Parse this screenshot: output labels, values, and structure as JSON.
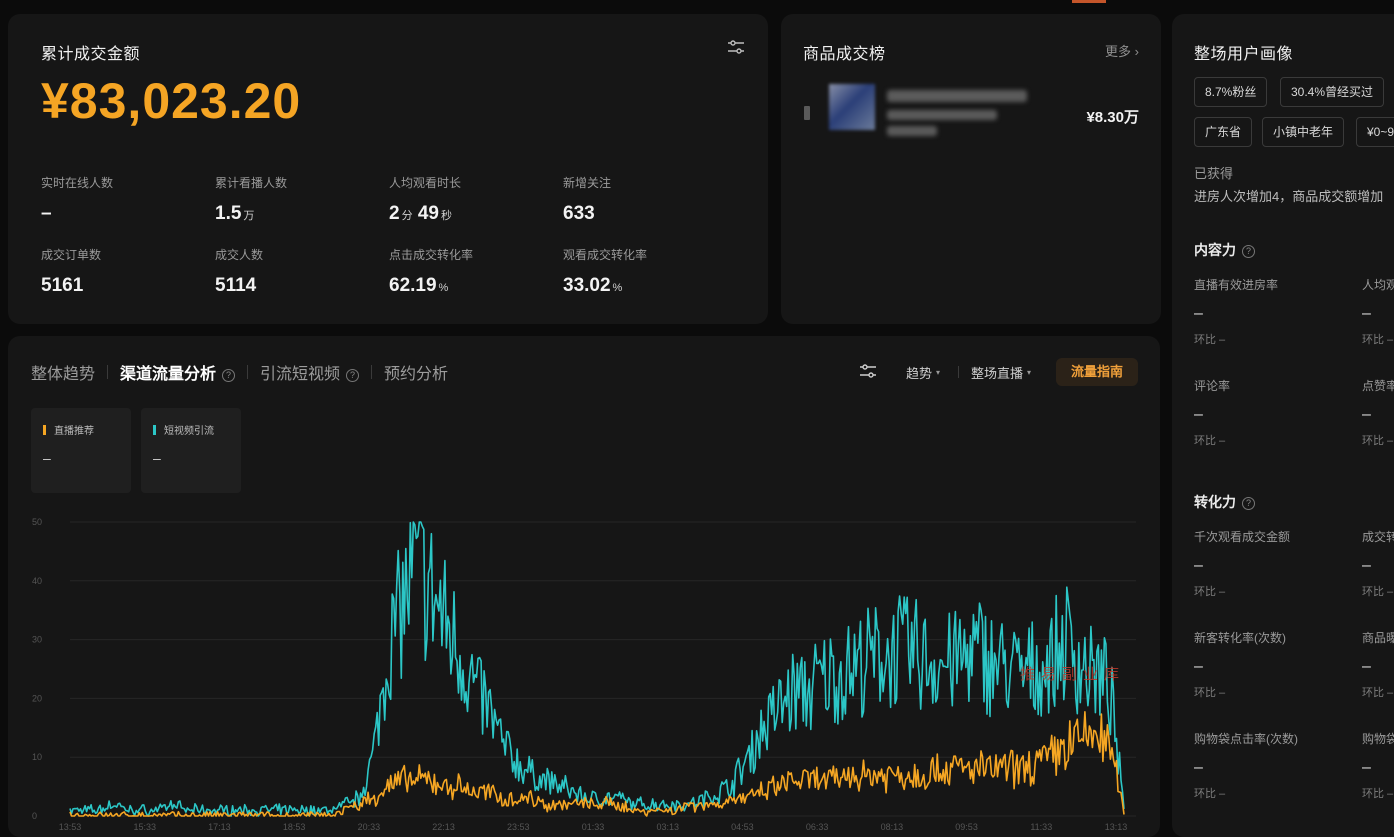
{
  "summary": {
    "title": "累计成交金额",
    "amount": "¥83,023.20",
    "metrics": [
      {
        "label": "实时在线人数",
        "value": "–",
        "unit": ""
      },
      {
        "label": "累计看播人数",
        "value": "1.5",
        "unit": "万"
      },
      {
        "label": "人均观看时长",
        "value": "2",
        "unit": "分",
        "value2": "49",
        "unit2": "秒"
      },
      {
        "label": "新增关注",
        "value": "633",
        "unit": ""
      },
      {
        "label": "成交订单数",
        "value": "5161",
        "unit": ""
      },
      {
        "label": "成交人数",
        "value": "5114",
        "unit": ""
      },
      {
        "label": "点击成交转化率",
        "value": "62.19",
        "unit": "%"
      },
      {
        "label": "观看成交转化率",
        "value": "33.02",
        "unit": "%"
      }
    ]
  },
  "products": {
    "title": "商品成交榜",
    "more": "更多",
    "items": [
      {
        "price": "¥8.30万"
      }
    ]
  },
  "profile": {
    "title": "整场用户画像",
    "tags_row1": [
      "8.7%粉丝",
      "30.4%曾经买过"
    ],
    "tags_row2": [
      "广东省",
      "小镇中老年",
      "¥0~9"
    ],
    "obtained_label": "已获得",
    "obtained_text": "进房人次增加4，商品成交额增加",
    "sections": [
      {
        "title": "内容力",
        "help": "?",
        "items": [
          {
            "label": "直播有效进房率",
            "value": "–",
            "hb": "环比 –"
          },
          {
            "label": "人均观",
            "value": "–",
            "hb": "环比 –"
          },
          {
            "label": "评论率",
            "value": "–",
            "hb": "环比 –"
          },
          {
            "label": "点赞率",
            "value": "–",
            "hb": "环比 –"
          }
        ]
      },
      {
        "title": "转化力",
        "help": "?",
        "items": [
          {
            "label": "千次观看成交金额",
            "value": "–",
            "hb": "环比 –"
          },
          {
            "label": "成交转",
            "value": "–",
            "hb": "环比 –"
          },
          {
            "label": "新客转化率(次数)",
            "value": "–",
            "hb": "环比 –"
          },
          {
            "label": "商品曝",
            "value": "–",
            "hb": "环比 –"
          },
          {
            "label": "购物袋点击率(次数)",
            "value": "–",
            "hb": "环比 –"
          },
          {
            "label": "购物袋",
            "value": "–",
            "hb": "环比 –"
          }
        ]
      }
    ]
  },
  "trend": {
    "tabs": [
      "整体趋势",
      "渠道流量分析",
      "引流短视频",
      "预约分析"
    ],
    "active_tab": 1,
    "controls": {
      "trend": "趋势",
      "scope": "整场直播",
      "guide": "流量指南"
    },
    "legend": [
      {
        "name": "直播推荐",
        "value": "–",
        "color": "#f5a623"
      },
      {
        "name": "短视频引流",
        "value": "–",
        "color": "#2cc7c7"
      }
    ],
    "watermark": "推易副业库"
  },
  "chart_data": {
    "type": "line",
    "ylim": [
      0,
      50
    ],
    "yticks": [
      "0",
      "10",
      "20",
      "30",
      "40",
      "50"
    ],
    "xticks": [
      "13:53",
      "15:33",
      "17:13",
      "18:53",
      "20:33",
      "22:13",
      "23:53",
      "01:33",
      "03:13",
      "04:53",
      "06:33",
      "08:13",
      "09:53",
      "11:33",
      "13:13"
    ],
    "grid": true,
    "series": [
      {
        "name": "短视频引流",
        "color": "#2cc7c7",
        "values": [
          1,
          1,
          1,
          2,
          1,
          1,
          1,
          2,
          1,
          1,
          1,
          1,
          1,
          1,
          1,
          1,
          1,
          1,
          1,
          2,
          3,
          10,
          28,
          36,
          42,
          38,
          33,
          28,
          22,
          18,
          12,
          9,
          7,
          6,
          5,
          4,
          3,
          3,
          3,
          2,
          2,
          2,
          2,
          2,
          3,
          4,
          6,
          10,
          15,
          18,
          21,
          21,
          23,
          24,
          25,
          26,
          27,
          28,
          28,
          27,
          26,
          26,
          27,
          28,
          26,
          25,
          24,
          25,
          26,
          30,
          26,
          24,
          22,
          1
        ]
      },
      {
        "name": "直播推荐",
        "color": "#f5a623",
        "values": [
          0,
          0,
          0,
          0,
          0,
          0,
          0,
          0,
          0,
          0,
          0,
          0,
          0,
          0,
          0,
          0,
          0,
          0,
          0,
          1,
          2,
          3,
          5,
          6,
          6,
          6,
          5,
          5,
          4,
          4,
          3,
          3,
          3,
          2,
          2,
          2,
          2,
          2,
          2,
          1,
          1,
          1,
          1,
          2,
          2,
          2,
          3,
          3,
          4,
          5,
          6,
          6,
          6,
          6,
          7,
          7,
          7,
          7,
          7,
          7,
          8,
          8,
          8,
          8,
          8,
          8,
          8,
          9,
          10,
          12,
          13,
          14,
          12,
          1
        ]
      }
    ]
  }
}
